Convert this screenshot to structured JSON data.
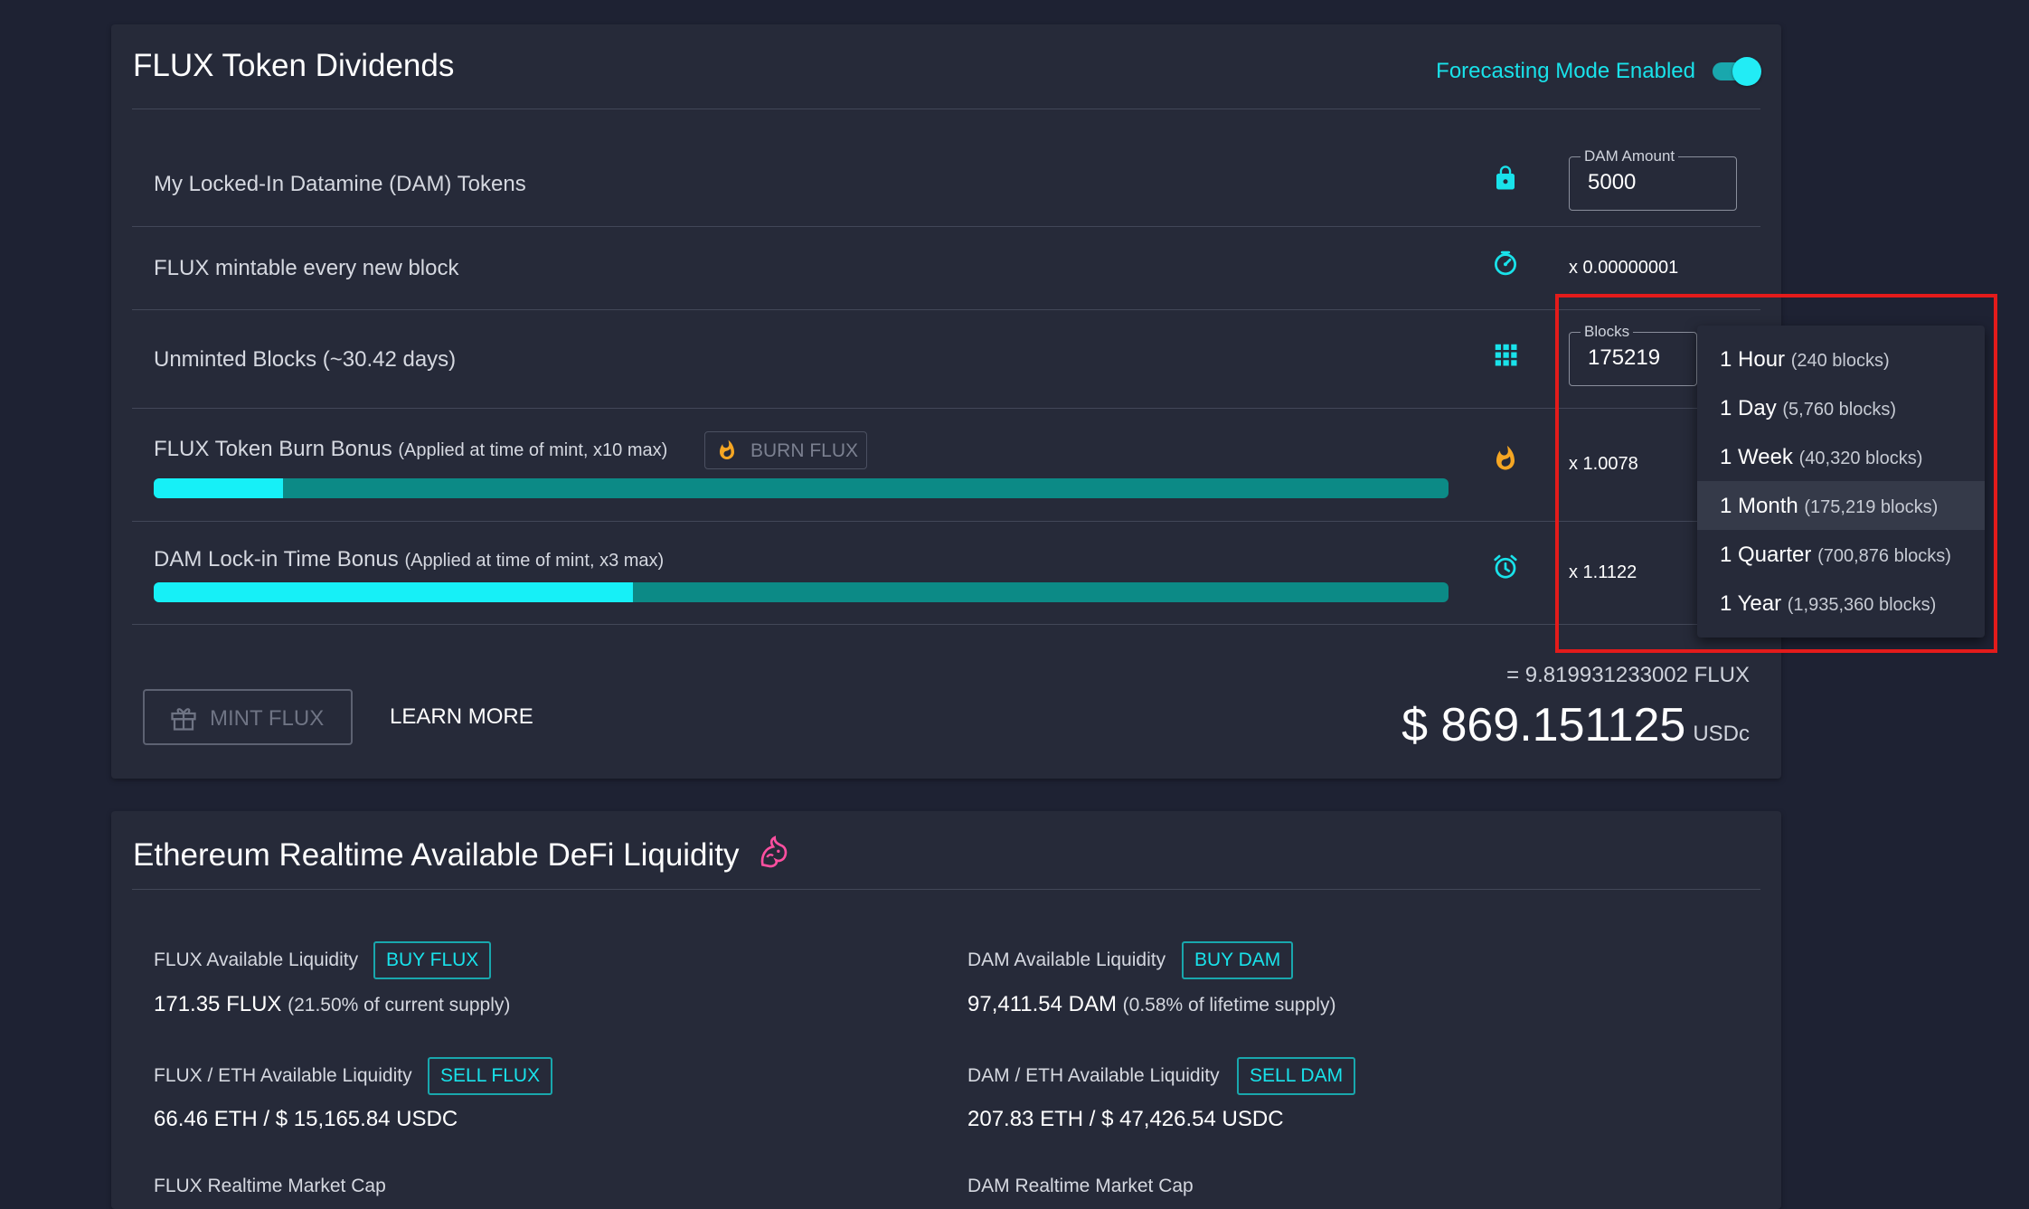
{
  "dividends": {
    "title": "FLUX Token Dividends",
    "forecasting_label": "Forecasting Mode Enabled",
    "forecasting_enabled": true,
    "locked_tokens": {
      "label": "My Locked-In Datamine (DAM) Tokens",
      "icon": "lock-icon",
      "field_label": "DAM Amount",
      "field_value": "5000"
    },
    "mintable": {
      "label": "FLUX mintable every new block",
      "icon": "timer-icon",
      "value": "x 0.00000001"
    },
    "unminted": {
      "label": "Unminted Blocks (~30.42 days)",
      "icon": "grid-icon",
      "field_label": "Blocks",
      "field_value": "175219"
    },
    "burn_bonus": {
      "label": "FLUX Token Burn Bonus",
      "note": "(Applied at time of mint, x10 max)",
      "button_label": "BURN FLUX",
      "icon": "fire-icon",
      "value": "x 1.0078",
      "progress": 0.1
    },
    "lockin_bonus": {
      "label": "DAM Lock-in Time Bonus",
      "note": "(Applied at time of mint, x3 max)",
      "icon": "alarm-icon",
      "value": "x 1.1122",
      "progress": 0.37
    },
    "mint_button": "MINT FLUX",
    "learn_more": "LEARN MORE",
    "total_flux": "= 9.819931233002 FLUX",
    "total_usd": "$ 869.151125",
    "total_unit": "USDc"
  },
  "blocks_menu": {
    "items": [
      {
        "label": "1 Hour",
        "detail": "(240 blocks)"
      },
      {
        "label": "1 Day",
        "detail": "(5,760 blocks)"
      },
      {
        "label": "1 Week",
        "detail": "(40,320 blocks)"
      },
      {
        "label": "1 Month",
        "detail": "(175,219 blocks)"
      },
      {
        "label": "1 Quarter",
        "detail": "(700,876 blocks)"
      },
      {
        "label": "1 Year",
        "detail": "(1,935,360 blocks)"
      }
    ],
    "selected": "1 Month",
    "highlight_color": "#e31b1b"
  },
  "liquidity": {
    "title": "Ethereum Realtime Available DeFi Liquidity",
    "icon": "uniswap-unicorn-icon",
    "flux_available": {
      "label": "FLUX Available Liquidity",
      "button": "BUY FLUX",
      "value": "171.35 FLUX",
      "note": "(21.50% of current supply)"
    },
    "dam_available": {
      "label": "DAM Available Liquidity",
      "button": "BUY DAM",
      "value": "97,411.54 DAM",
      "note": "(0.58% of lifetime supply)"
    },
    "flux_eth": {
      "label": "FLUX / ETH Available Liquidity",
      "button": "SELL FLUX",
      "value": "66.46 ETH / $ 15,165.84 USDC"
    },
    "dam_eth": {
      "label": "DAM / ETH Available Liquidity",
      "button": "SELL DAM",
      "value": "207.83 ETH / $ 47,426.54 USDC"
    },
    "flux_market_cap_label": "FLUX Realtime Market Cap",
    "dam_market_cap_label": "DAM Realtime Market Cap"
  },
  "colors": {
    "accent": "#19e2ea",
    "background": "#1e2233",
    "card": "#262a39",
    "bar_track": "#0c8a86",
    "bar_fill": "#16f0f7",
    "fire": "#f5a623"
  }
}
